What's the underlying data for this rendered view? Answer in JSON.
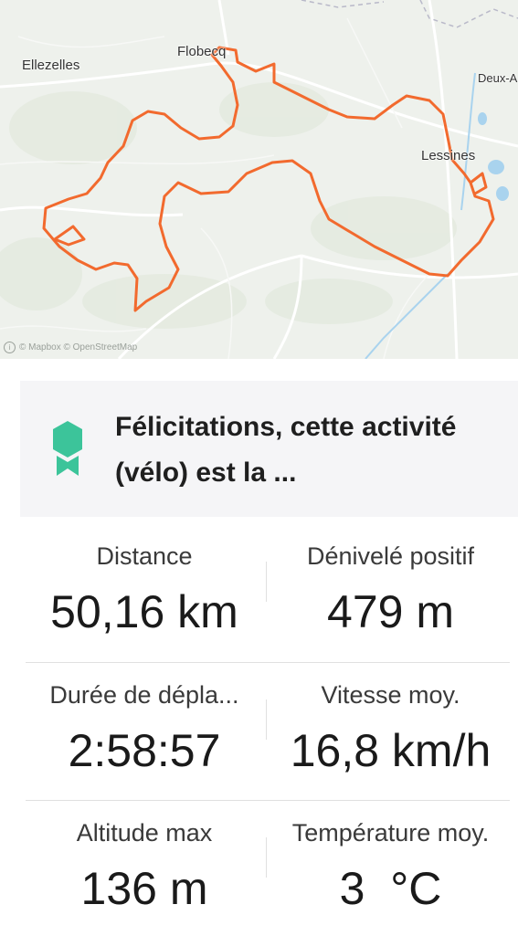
{
  "map": {
    "labels": {
      "ellezelles": "Ellezelles",
      "flobecq": "Flobecq",
      "deux_acren": "Deux-A",
      "lessines": "Lessines"
    },
    "attribution": "© Mapbox © OpenStreetMap",
    "route_color": "#f26a2e",
    "water_color": "#a9d3ee"
  },
  "achievement": {
    "text": "Félicitations, cette activité (vélo) est la ...",
    "badge_color": "#3cc49a",
    "badge_icon": "ribbon-medal-icon"
  },
  "stats": [
    {
      "label": "Distance",
      "value": "50,16 km"
    },
    {
      "label": "Dénivelé positif",
      "value": "479 m"
    },
    {
      "label": "Durée de dépla...",
      "value": "2:58:57"
    },
    {
      "label": "Vitesse moy.",
      "value": "16,8 km/h"
    },
    {
      "label": "Altitude max",
      "value": "136 m"
    },
    {
      "label": "Température moy.",
      "value": "3  °C"
    }
  ]
}
